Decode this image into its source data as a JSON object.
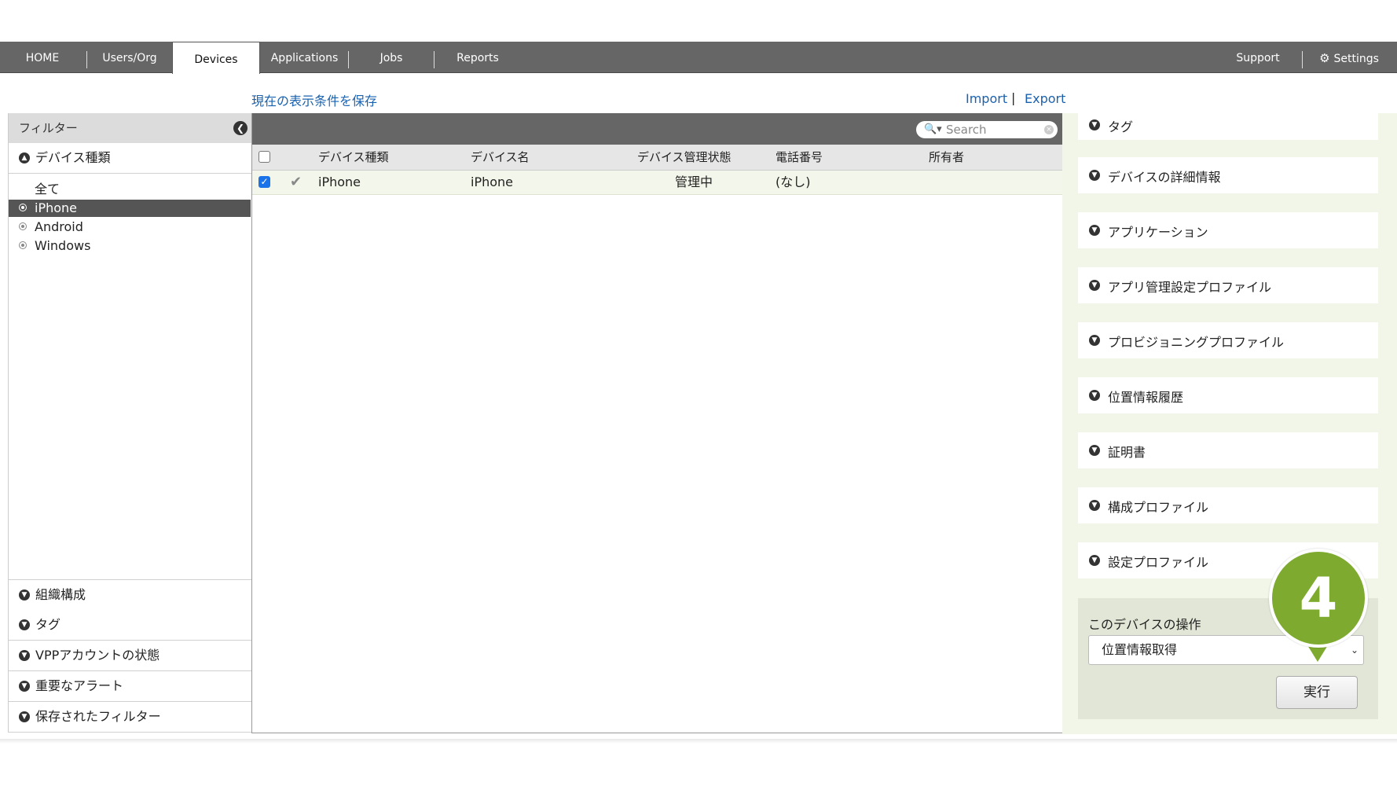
{
  "nav": {
    "tabs": [
      {
        "label": "HOME"
      },
      {
        "label": "Users/Org"
      },
      {
        "label": "Devices"
      },
      {
        "label": "Applications"
      },
      {
        "label": "Jobs"
      },
      {
        "label": "Reports"
      }
    ],
    "support": "Support",
    "settings": "Settings"
  },
  "toolbar": {
    "save_view": "現在の表示条件を保存",
    "import": "Import",
    "separator": "|",
    "export": "Export"
  },
  "filter": {
    "header": "フィルター",
    "device_type_section": "デバイス種類",
    "device_types": [
      "全て",
      "iPhone",
      "Android",
      "Windows"
    ],
    "selected": "iPhone",
    "bottom_sections": [
      "組織構成",
      "タグ",
      "VPPアカウントの状態",
      "重要なアラート",
      "保存されたフィルター"
    ]
  },
  "search": {
    "placeholder": "Search"
  },
  "table": {
    "columns": [
      "デバイス種類",
      "デバイス名",
      "デバイス管理状態",
      "電話番号",
      "所有者"
    ],
    "rows": [
      {
        "type": "iPhone",
        "name": "iPhone",
        "status": "管理中",
        "phone": "(なし)",
        "owner": "",
        "checked": true
      }
    ]
  },
  "detail": {
    "sections": [
      "タグ",
      "デバイスの詳細情報",
      "アプリケーション",
      "アプリ管理設定プロファイル",
      "プロビジョニングプロファイル",
      "位置情報履歴",
      "証明書",
      "構成プロファイル",
      "設定プロファイル"
    ],
    "ops_label": "このデバイスの操作",
    "ops_selected": "位置情報取得",
    "run_button": "実行"
  },
  "step_marker": "4",
  "colors": {
    "nav_bg": "#666666",
    "accent_green": "#7eab2f",
    "link": "#1a62b0",
    "panel_green": "#f2f6e8"
  }
}
